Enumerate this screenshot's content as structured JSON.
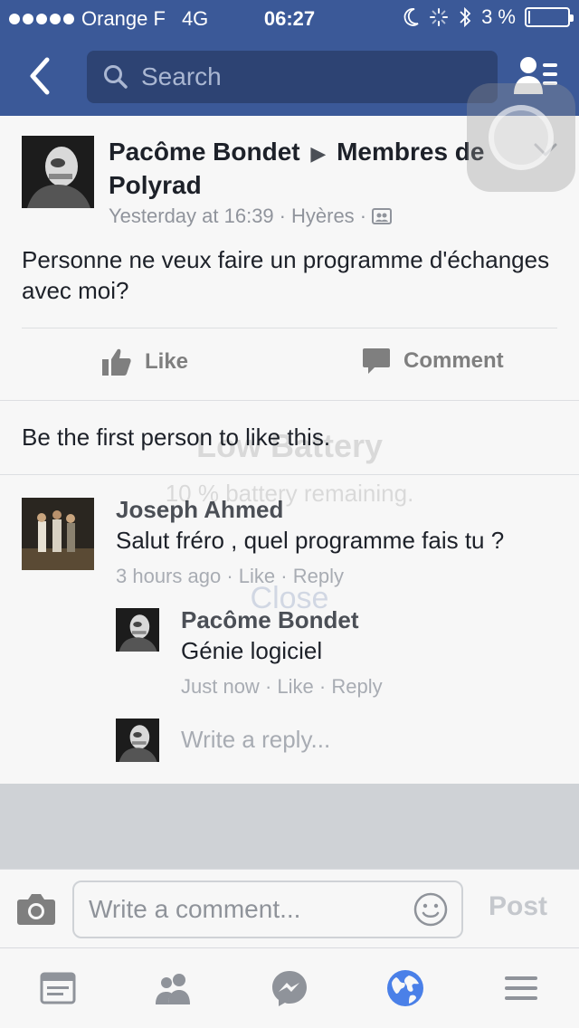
{
  "status_bar": {
    "carrier": "Orange F",
    "network": "4G",
    "time": "06:27",
    "battery_text": "3 %",
    "battery_level": 0.03,
    "signal_dots": 5
  },
  "nav": {
    "search_placeholder": "Search"
  },
  "post": {
    "author": "Pacôme Bondet",
    "separator": "▶",
    "group": "Membres de Polyrad",
    "time": "Yesterday at 16:39",
    "location": "Hyères",
    "text": "Personne ne veux faire un programme d'échanges avec moi?",
    "like_label": "Like",
    "comment_label": "Comment",
    "likes_summary": "Be the first person to like this."
  },
  "comments": [
    {
      "name": "Joseph Ahmed",
      "text": "Salut fréro , quel programme fais tu ?",
      "time": "3 hours ago",
      "like": "Like",
      "reply": "Reply"
    },
    {
      "name": "Pacôme Bondet",
      "text": "Génie logiciel",
      "time": "Just now",
      "like": "Like",
      "reply": "Reply"
    }
  ],
  "reply_placeholder": "Write a reply...",
  "alert": {
    "title": "Low Battery",
    "message": "10 % battery remaining.",
    "close": "Close"
  },
  "composer": {
    "placeholder": "Write a comment...",
    "post_label": "Post"
  },
  "tabbar": {
    "items": [
      "news-feed-icon",
      "friends-icon",
      "messenger-icon",
      "notifications-globe-icon",
      "menu-icon"
    ],
    "active_index": 3
  },
  "colors": {
    "brand": "#3b5998",
    "active_tab": "#4a80e8",
    "muted_text": "#90949c"
  }
}
